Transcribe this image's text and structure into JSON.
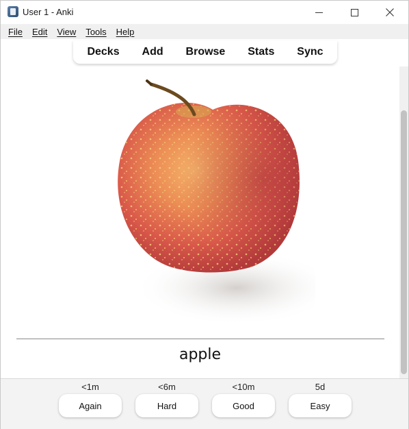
{
  "window": {
    "title": "User 1 - Anki",
    "icon": "anki-app-icon"
  },
  "menu": {
    "items": [
      {
        "label": "File"
      },
      {
        "label": "Edit"
      },
      {
        "label": "View"
      },
      {
        "label": "Tools"
      },
      {
        "label": "Help"
      }
    ]
  },
  "toolbar": {
    "items": [
      {
        "label": "Decks"
      },
      {
        "label": "Add"
      },
      {
        "label": "Browse"
      },
      {
        "label": "Stats"
      },
      {
        "label": "Sync"
      }
    ]
  },
  "card": {
    "image": "apple-photo",
    "answer": "apple"
  },
  "answers": [
    {
      "time": "<1m",
      "label": "Again"
    },
    {
      "time": "<6m",
      "label": "Hard"
    },
    {
      "time": "<10m",
      "label": "Good"
    },
    {
      "time": "5d",
      "label": "Easy"
    }
  ]
}
